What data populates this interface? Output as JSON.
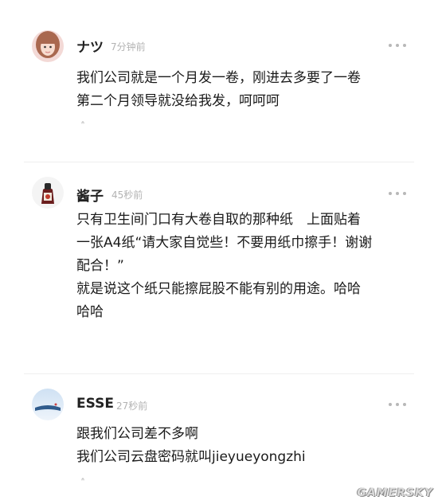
{
  "comments": [
    {
      "username": "ナツ",
      "time": "7分钟前",
      "lines": [
        "我们公司就是一个月发一卷，刚进去多要了一卷",
        "第二个月领导就没给我发，呵呵呵"
      ],
      "reply_mark": "ᐢ"
    },
    {
      "username": "酱子",
      "time": "45秒前",
      "lines": [
        "只有卫生间门口有大卷自取的那种纸　上面贴着",
        "一张A4纸“请大家自觉些！不要用纸巾擦手！谢谢",
        "配合！”",
        "就是说这个纸只能擦屁股不能有别的用途。哈哈",
        "哈哈"
      ]
    },
    {
      "username": "ESSE",
      "time": "27秒前",
      "lines": [
        "跟我们公司差不多啊",
        "我们公司云盘密码就叫jieyueyongzhi"
      ],
      "reply_mark": "ᐢ"
    }
  ],
  "watermark": "GAMERSKY"
}
